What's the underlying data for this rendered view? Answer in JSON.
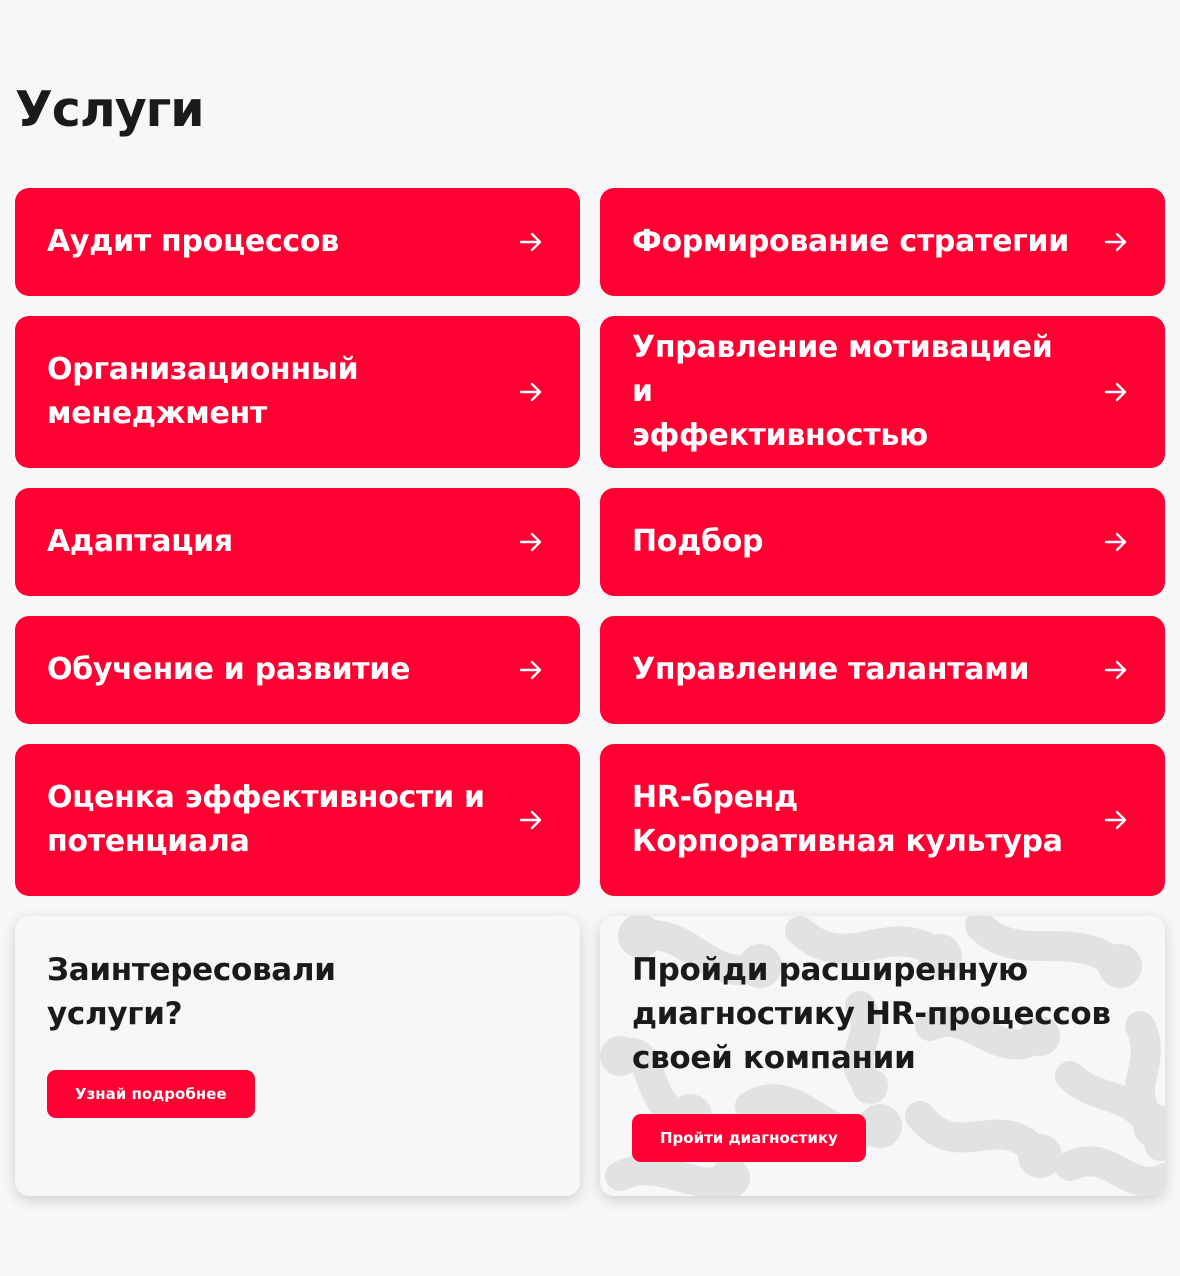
{
  "section": {
    "title": "Услуги"
  },
  "services": [
    {
      "label": "Аудит процессов",
      "icon": "arrow-right-icon"
    },
    {
      "label": "Формирование стратегии",
      "icon": "arrow-right-icon"
    },
    {
      "label": "Организационный\nменеджмент",
      "icon": "arrow-right-icon"
    },
    {
      "label": "Управление мотивацией и\nэффективностью",
      "icon": "arrow-right-icon"
    },
    {
      "label": "Адаптация",
      "icon": "arrow-right-icon"
    },
    {
      "label": "Подбор",
      "icon": "arrow-right-icon"
    },
    {
      "label": "Обучение и развитие",
      "icon": "arrow-right-icon"
    },
    {
      "label": "Управление талантами",
      "icon": "arrow-right-icon"
    },
    {
      "label": "Оценка эффективности и\nпотенциала",
      "icon": "arrow-right-icon"
    },
    {
      "label": "HR-бренд\nКорпоративная культура",
      "icon": "arrow-right-icon"
    }
  ],
  "cta_interest": {
    "title": "Заинтересовали\nуслуги?",
    "button_label": "Узнай подробнее"
  },
  "cta_diagnostics": {
    "title": "Пройди расширенную\nдиагностику HR-процессов\nсвоей компании",
    "button_label": "Пройти диагностику"
  },
  "colors": {
    "accent": "#ff0033",
    "background": "#f7f7f9",
    "text": "#1a1a1a",
    "card_text": "#ffffff",
    "pattern": "#e2e2e5"
  }
}
